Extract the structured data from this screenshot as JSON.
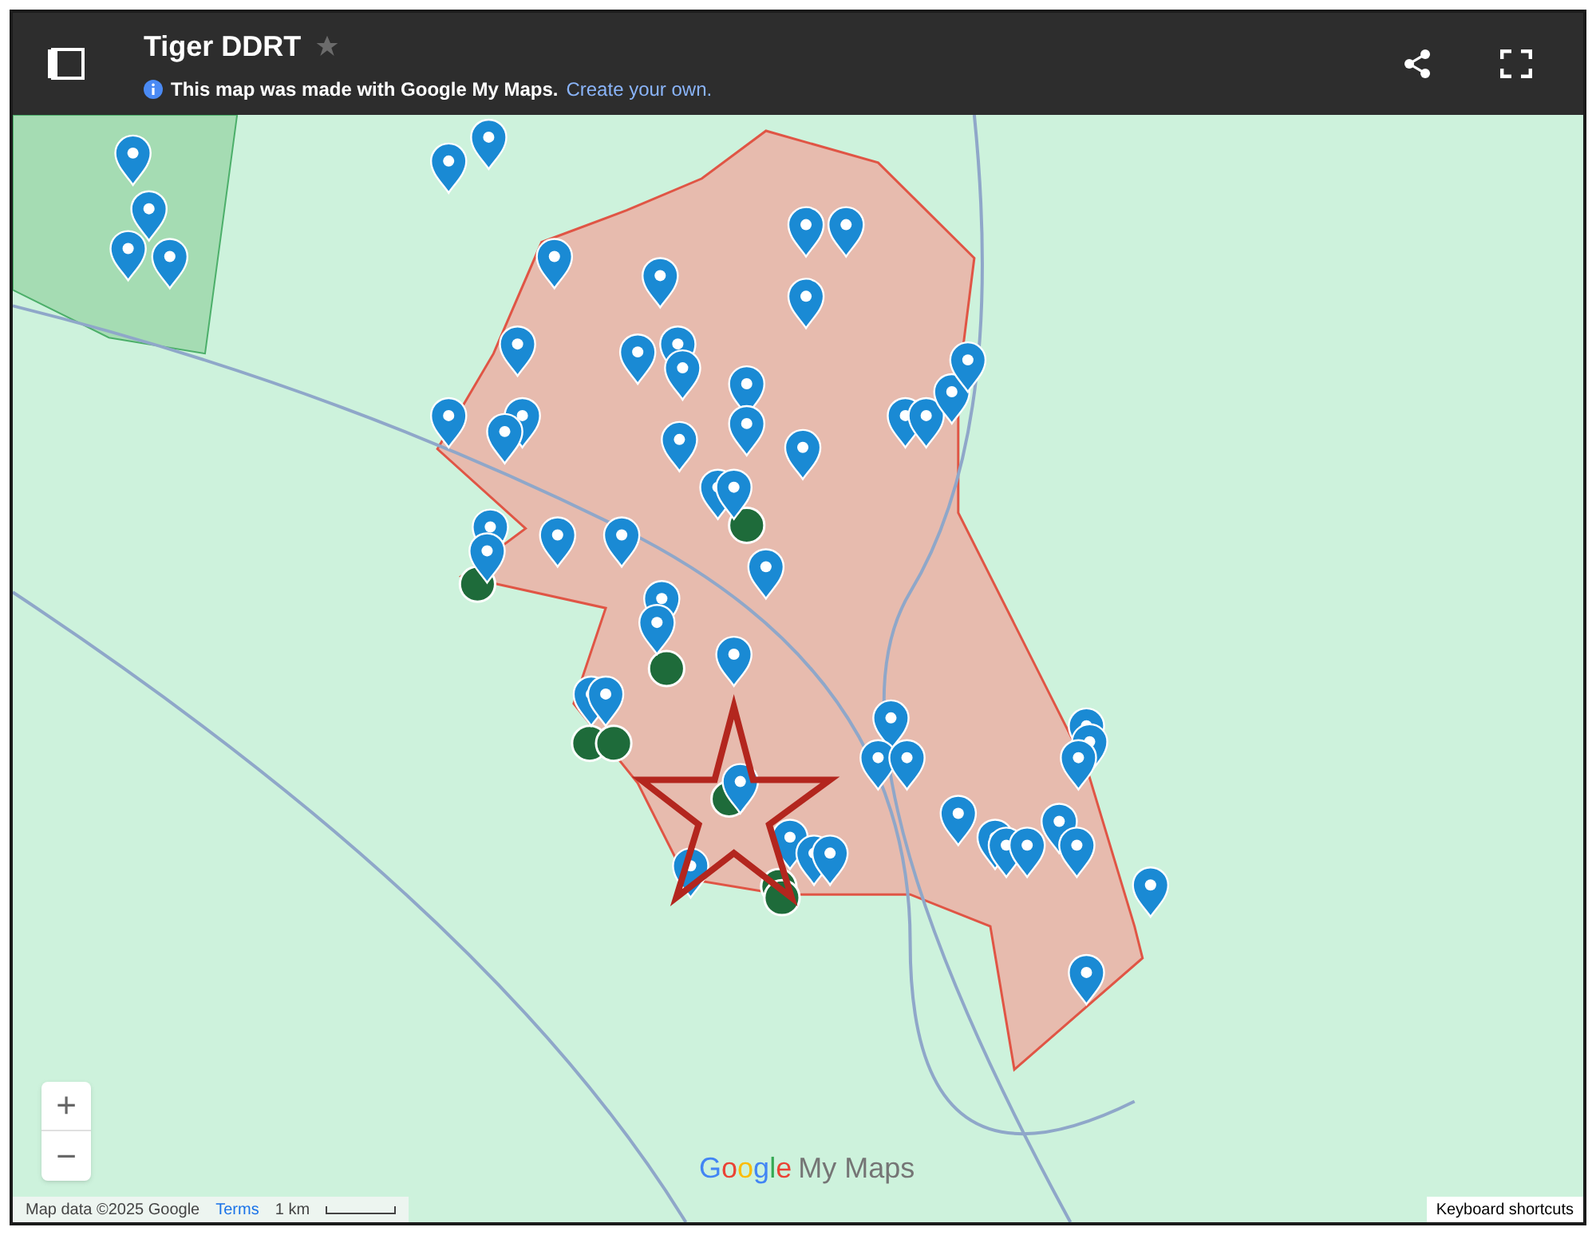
{
  "header": {
    "title": "Tiger DDRT",
    "starred": false,
    "notice": "This map was made with Google My Maps.",
    "notice_link": "Create your own."
  },
  "map": {
    "zoom_in": "+",
    "zoom_out": "−",
    "logo": {
      "brand": "Google",
      "product": "My Maps"
    },
    "attribution": "Map data ©2025 Google",
    "terms": "Terms",
    "scale": "1 km",
    "shortcuts": "Keyboard shortcuts"
  }
}
